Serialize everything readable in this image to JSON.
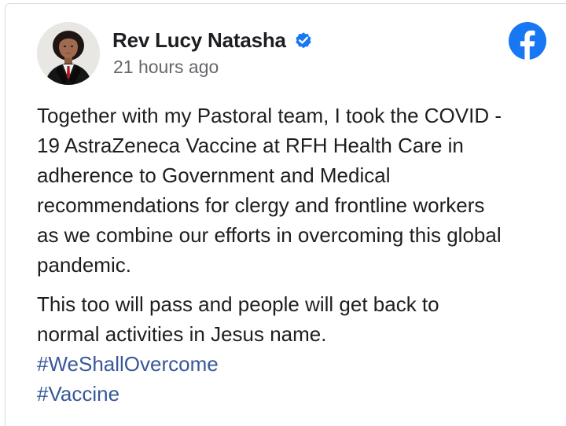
{
  "post": {
    "author": {
      "name": "Rev Lucy Natasha",
      "verified_icon": "verified-badge-icon",
      "avatar_icon": "profile-photo"
    },
    "timestamp": "21 hours ago",
    "platform_icon": "facebook-icon",
    "paragraphs": [
      "Together with my Pastoral team, I took the COVID -\n19 AstraZeneca Vaccine at RFH Health Care in\nadherence to Government and Medical\nrecommendations for clergy and frontline workers\nas we combine our efforts in overcoming this global\npandemic.",
      "This too will pass and people will get back to\nnormal activities in Jesus name."
    ],
    "hashtags": [
      "#WeShallOvercome",
      "#Vaccine"
    ]
  },
  "colors": {
    "facebook_blue": "#1877f2",
    "hashtag_link": "#385898",
    "verified_blue": "#1877f2",
    "timestamp_gray": "#65676b",
    "text": "#1c1e21"
  }
}
